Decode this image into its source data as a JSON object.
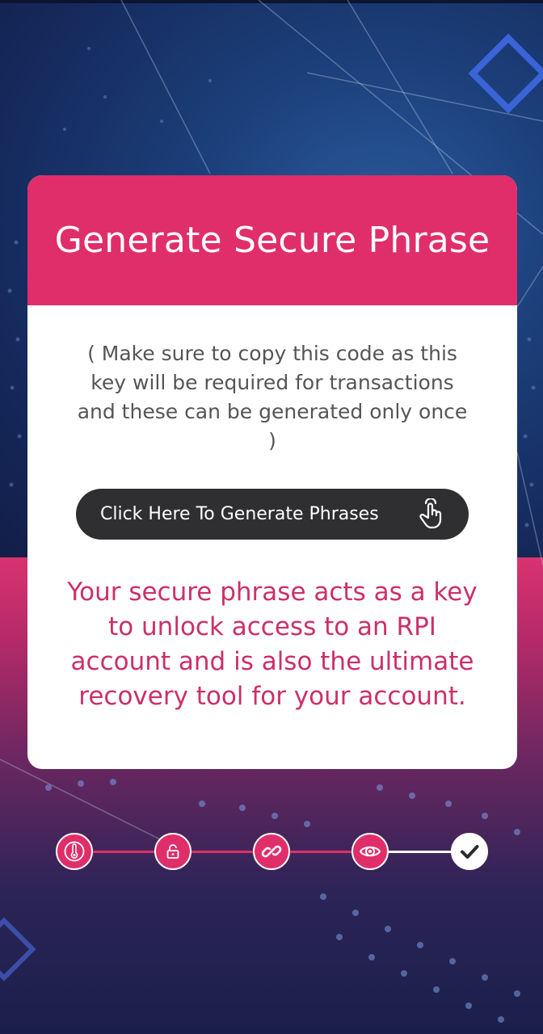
{
  "card": {
    "title": "Generate Secure Phrase",
    "note": "( Make sure to copy this code as this key will be required for transactions and these can be generated only once )",
    "generate_button_label": "Click Here To Generate Phrases",
    "info": "Your secure phrase acts as a key to unlock access to an RPI account and is also the ultimate recovery tool for your account."
  },
  "stepper": {
    "steps": [
      {
        "icon": "thermometer-icon",
        "state": "completed"
      },
      {
        "icon": "unlock-icon",
        "state": "completed"
      },
      {
        "icon": "link-icon",
        "state": "completed"
      },
      {
        "icon": "eye-icon",
        "state": "completed"
      },
      {
        "icon": "checkmark-icon",
        "state": "current"
      }
    ]
  },
  "colors": {
    "accent": "#e02e6a",
    "button_bg": "#2f2f31",
    "info_text": "#cc2f6b",
    "note_text": "#555555"
  }
}
